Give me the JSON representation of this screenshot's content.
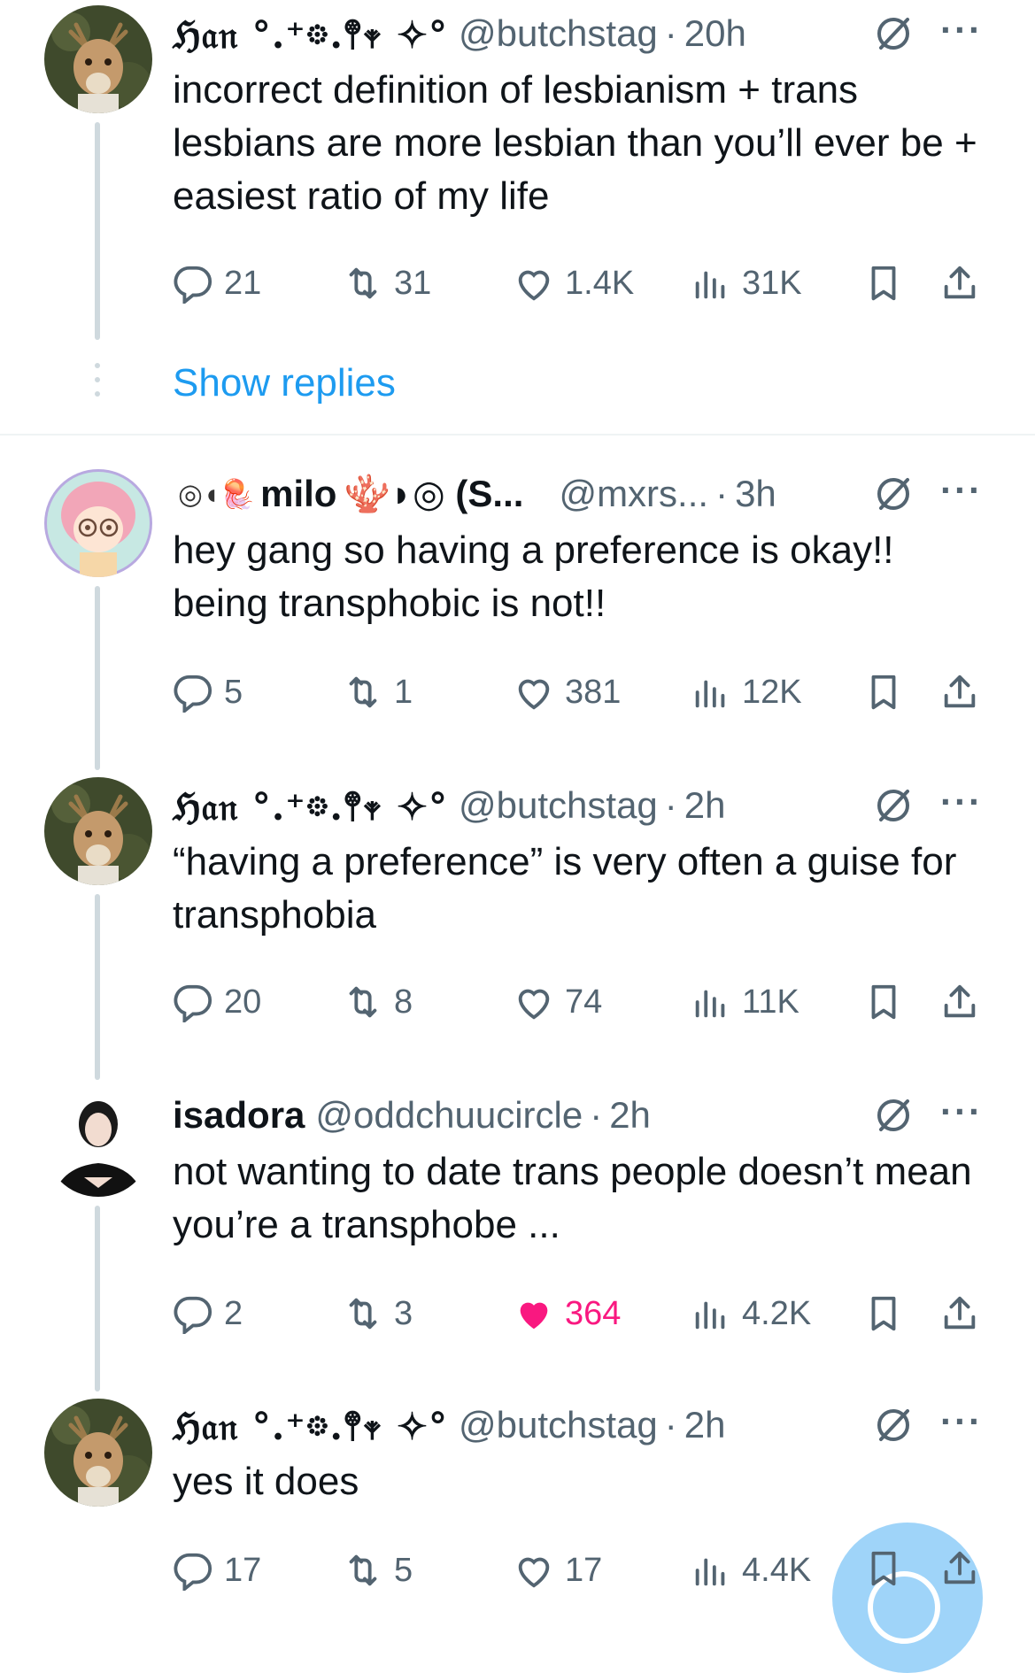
{
  "tweets": [
    {
      "name": "ℌ𝔞𝔫 °.⁺𖡼.𖤣𖥧 ✧°",
      "handle": "@butchstag",
      "time": "20h",
      "text": "incorrect definition of lesbianism + trans lesbians are more lesbian than you’ll ever be + easiest ratio of my life",
      "replies": "21",
      "reposts": "31",
      "likes": "1.4K",
      "views": "31K"
    },
    {
      "name": "milo",
      "name_prefix": "◎◖🪼",
      "name_suffix": "🪸◗◎ (S...",
      "handle": "@mxrs...",
      "time": "3h",
      "text": "hey gang so having a preference is okay!! being transphobic is not!!",
      "replies": "5",
      "reposts": "1",
      "likes": "381",
      "views": "12K"
    },
    {
      "name": "ℌ𝔞𝔫 °.⁺𖡼.𖤣𖥧 ✧°",
      "handle": "@butchstag",
      "time": "2h",
      "text": "“having a preference” is very often a guise for transphobia",
      "replies": "20",
      "reposts": "8",
      "likes": "74",
      "views": "11K"
    },
    {
      "name": "isadora",
      "handle": "@oddchuucircle",
      "time": "2h",
      "text": "not wanting to date trans people doesn’t mean you’re a transphobe ...",
      "replies": "2",
      "reposts": "3",
      "likes": "364",
      "views": "4.2K"
    },
    {
      "name": "ℌ𝔞𝔫 °.⁺𖡼.𖤣𖥧 ✧°",
      "handle": "@butchstag",
      "time": "2h",
      "text": "yes it does",
      "replies": "17",
      "reposts": "5",
      "likes": "17",
      "views": "4.4K"
    }
  ],
  "show_replies": "Show replies",
  "colors": {
    "link": "#1d9bf0",
    "liked": "#f91880",
    "muted": "#536471",
    "thread_line": "#cfd9de"
  },
  "icons": [
    "reply-icon",
    "repost-icon",
    "heart-icon",
    "views-icon",
    "bookmark-icon",
    "share-icon",
    "grok-icon",
    "more-icon"
  ]
}
